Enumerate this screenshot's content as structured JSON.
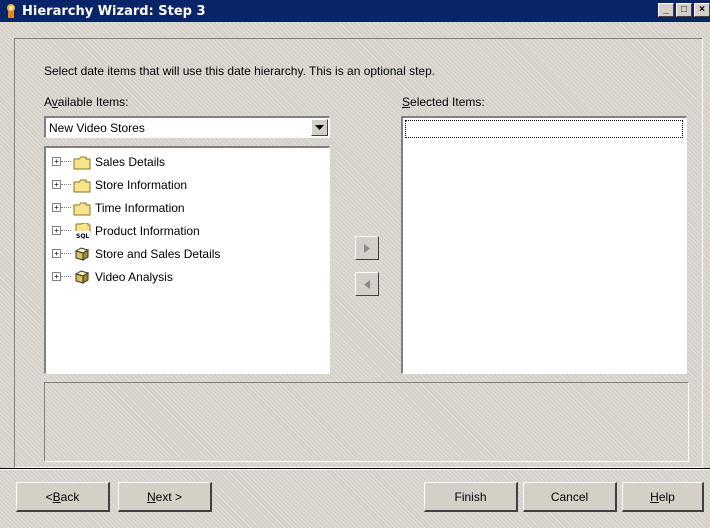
{
  "window": {
    "title": "Hierarchy Wizard: Step 3",
    "controls": [
      "_",
      "□",
      "×"
    ]
  },
  "instructions": "Select date items that will use this date hierarchy. This is an optional step.",
  "available": {
    "label_pre": "A",
    "label_underline": "v",
    "label_post": "ailable Items:",
    "combo_value": "New Video Stores",
    "items": [
      {
        "label": "Sales Details",
        "icon": "folder-icon"
      },
      {
        "label": "Store Information",
        "icon": "folder-icon"
      },
      {
        "label": "Time Information",
        "icon": "folder-icon"
      },
      {
        "label": "Product Information",
        "icon": "sql-table-icon"
      },
      {
        "label": "Store and Sales Details",
        "icon": "cube-icon"
      },
      {
        "label": "Video Analysis",
        "icon": "cube-icon"
      }
    ]
  },
  "selected": {
    "label_underline": "S",
    "label_post": "elected Items:"
  },
  "buttons": {
    "back_underline": "B",
    "back_pre": "< ",
    "back_post": "ack",
    "next_underline": "N",
    "next_post": "ext >",
    "finish": "Finish",
    "cancel": "Cancel",
    "help_underline": "H",
    "help_post": "elp"
  }
}
